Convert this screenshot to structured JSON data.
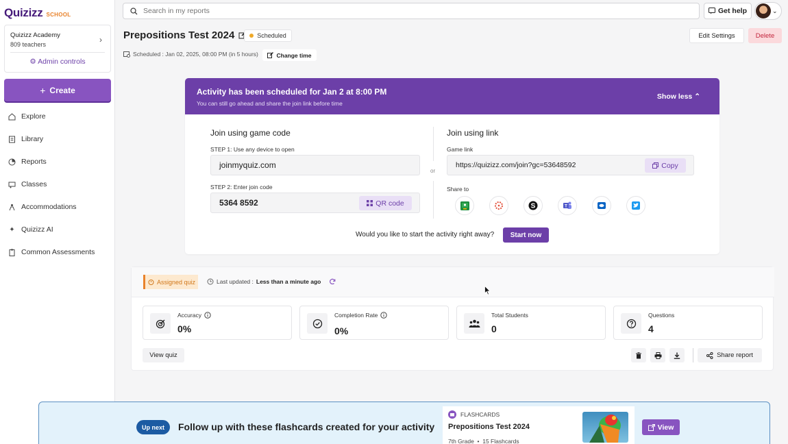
{
  "brand": {
    "logo": "Quizizz",
    "tag": "SCHOOL"
  },
  "org": {
    "name": "Quizizz Academy",
    "teachers": "809 teachers",
    "admin_label": "Admin controls"
  },
  "create_label": "Create",
  "nav": [
    {
      "label": "Explore",
      "icon": "home-icon"
    },
    {
      "label": "Library",
      "icon": "library-icon"
    },
    {
      "label": "Reports",
      "icon": "reports-icon"
    },
    {
      "label": "Classes",
      "icon": "classes-icon"
    },
    {
      "label": "Accommodations",
      "icon": "accommodations-icon"
    },
    {
      "label": "Quizizz AI",
      "icon": "sparkle-icon"
    },
    {
      "label": "Common Assessments",
      "icon": "clipboard-icon"
    }
  ],
  "search": {
    "placeholder": "Search in my reports"
  },
  "help_label": "Get help",
  "page": {
    "title": "Prepositions Test 2024",
    "status": "Scheduled",
    "schedule_text": "Scheduled :  Jan 02, 2025, 08:00 PM (in 5 hours)",
    "change_time": "Change time",
    "edit_settings": "Edit Settings",
    "delete": "Delete"
  },
  "join": {
    "banner_title": "Activity has been scheduled for Jan 2 at 8:00 PM",
    "banner_sub": "You can still go ahead and share the join link before time",
    "show_less": "Show less",
    "code_heading": "Join using game code",
    "step1": "STEP 1: Use any device to open",
    "site": "joinmyquiz.com",
    "step2": "STEP 2: Enter join code",
    "code": "5364 8592",
    "qr_label": "QR code",
    "or": "or",
    "link_heading": "Join using link",
    "game_link_label": "Game link",
    "game_link": "https://quizizz.com/join?gc=53648592",
    "copy_label": "Copy",
    "share_to": "Share to",
    "share_icons": [
      "google-classroom-icon",
      "canvas-icon",
      "schoology-icon",
      "teams-icon",
      "outlook-icon",
      "twitter-icon"
    ],
    "start_prompt": "Would you like to start the activity right away?",
    "start_now": "Start now"
  },
  "stats": {
    "assigned": "Assigned quiz",
    "last_updated_label": "Last updated :",
    "last_updated_value": "Less than a minute ago",
    "cards": [
      {
        "title": "Accuracy",
        "value": "0%",
        "icon": "target-icon"
      },
      {
        "title": "Completion Rate",
        "value": "0%",
        "icon": "check-circle-icon"
      },
      {
        "title": "Total Students",
        "value": "0",
        "icon": "students-icon"
      },
      {
        "title": "Questions",
        "value": "4",
        "icon": "question-icon"
      }
    ],
    "view_quiz": "View quiz",
    "share_report": "Share report"
  },
  "upnext": {
    "badge": "Up next",
    "text": "Follow up with these flashcards created for your activity",
    "type": "FLASHCARDS",
    "title": "Prepositions Test 2024",
    "meta": "7th Grade  •  15 Flashcards",
    "view": "View"
  },
  "colors": {
    "primary": "#8854c0",
    "banner": "#6c3fa8",
    "status": "#efa929",
    "danger": "#c2243c",
    "upnext_bg": "#e3f2fb"
  }
}
